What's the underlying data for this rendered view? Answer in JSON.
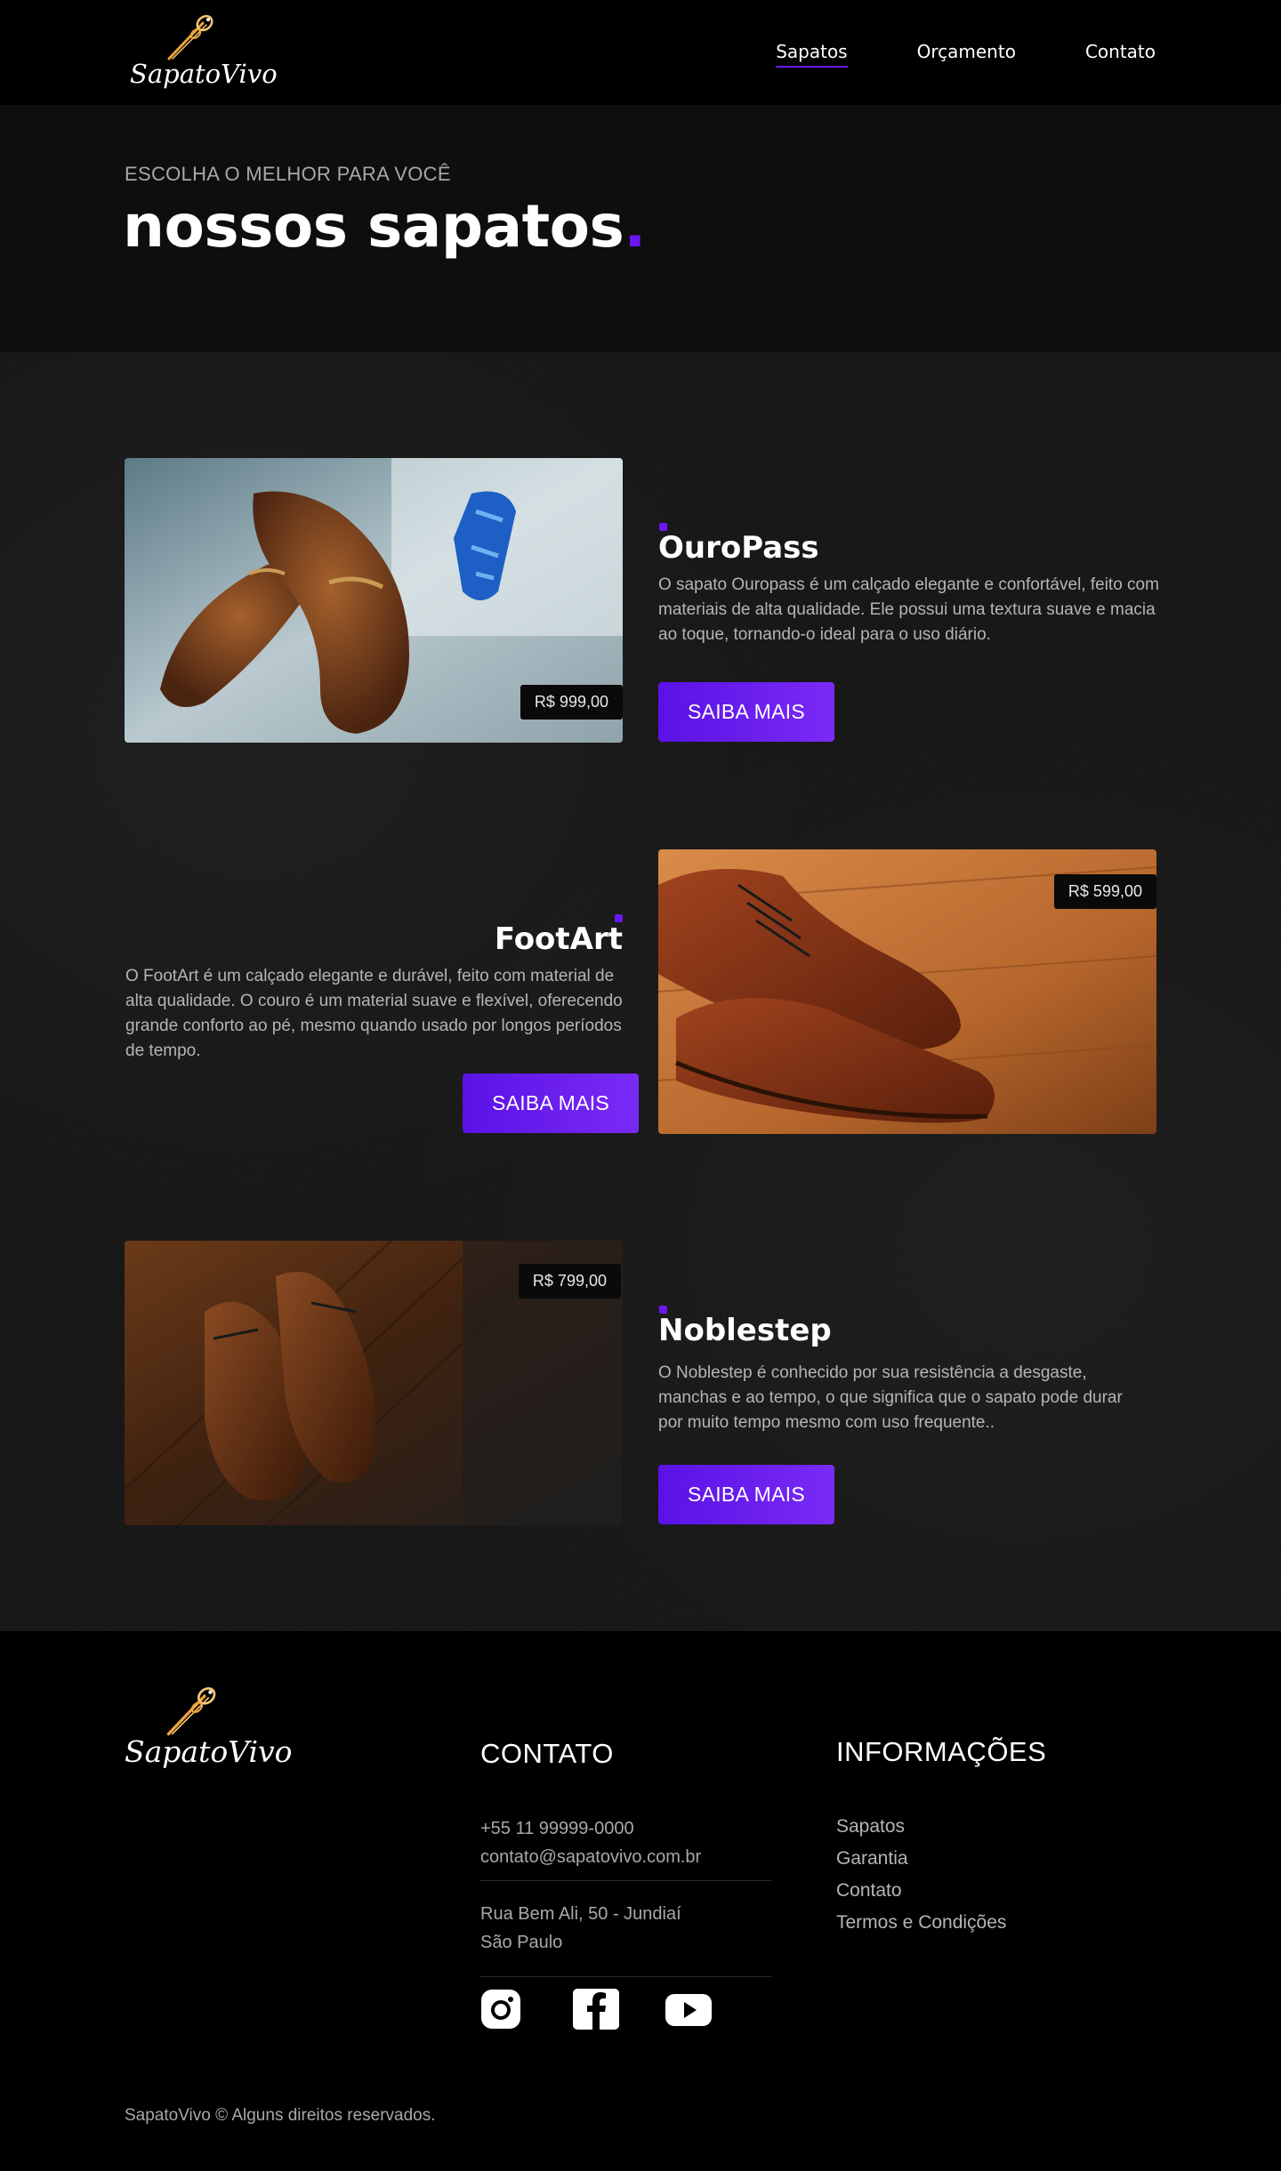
{
  "header": {
    "logo_text": "SapatoVivo",
    "nav": [
      {
        "label": "Sapatos",
        "active": true
      },
      {
        "label": "Orçamento",
        "active": false
      },
      {
        "label": "Contato",
        "active": false
      }
    ]
  },
  "hero": {
    "eyebrow": "ESCOLHA O MELHOR PARA VOCÊ",
    "title": "nossos sapatos",
    "title_dot": "."
  },
  "products": [
    {
      "name": "OuroPass",
      "price": "R$ 999,00",
      "description": "O  sapato Ouropass é um calçado elegante e confortável, feito com materiais de alta qualidade. Ele possui uma textura suave e macia ao toque, tornando-o ideal para o uso diário.",
      "button": "SAIBA MAIS"
    },
    {
      "name": "FootArt",
      "price": "R$ 599,00",
      "description": "O FootArt é um calçado elegante e durável, feito com material de alta qualidade. O couro é um material suave e flexível, oferecendo grande conforto ao pé, mesmo quando usado por longos períodos de tempo.",
      "button": "SAIBA MAIS"
    },
    {
      "name": "Noblestep",
      "price": "R$ 799,00",
      "description": "O Noblestep é conhecido por sua resistência a desgaste, manchas e ao tempo, o que significa que o sapato pode durar por muito tempo mesmo com uso frequente..",
      "button": "SAIBA MAIS"
    }
  ],
  "footer": {
    "logo_text": "SapatoVivo",
    "contact_title": "CONTATO",
    "phone": "+55 11 99999-0000",
    "email": "contato@sapatovivo.com.br",
    "address_line1": "Rua Bem Ali, 50 - Jundiaí",
    "address_line2": "São Paulo",
    "social": [
      "instagram-icon",
      "facebook-icon",
      "youtube-icon"
    ],
    "info_title": "INFORMAÇÕES",
    "info_links": [
      "Sapatos",
      "Garantia",
      "Contato",
      "Termos e Condições"
    ],
    "copyright": "SapatoVivo © Alguns direitos reservados."
  },
  "colors": {
    "accent": "#6a18f0",
    "background": "#000000",
    "hero_bg": "#0e0e0e",
    "products_bg": "#161616"
  }
}
